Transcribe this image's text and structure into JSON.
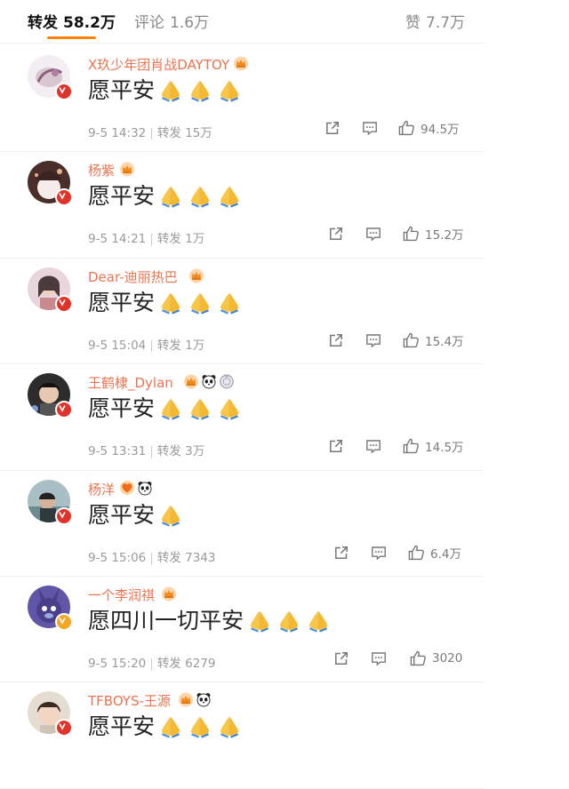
{
  "tabs": {
    "repost": {
      "label": "转发",
      "count": "58.2万"
    },
    "comment": {
      "label": "评论",
      "count": "1.6万"
    },
    "like": {
      "label": "赞",
      "count": "7.7万"
    }
  },
  "colors": {
    "accent": "#ff8200",
    "username": "#eb7350",
    "verified_red": "#e0332a",
    "verified_gold": "#f5a623"
  },
  "items": [
    {
      "username": "X玖少年团肖战DAYTOY",
      "badges": [
        "crown-icon"
      ],
      "comment": "愿平安",
      "pray_count": 3,
      "time": "9-5 14:32",
      "repost_label": "转发",
      "repost_count": "15万",
      "likes": "94.5万",
      "verified": "red",
      "avatar_color": "#d9c7cf"
    },
    {
      "username": "杨紫",
      "badges": [
        "crown-icon"
      ],
      "comment": "愿平安",
      "pray_count": 3,
      "time": "9-5 14:21",
      "repost_label": "转发",
      "repost_count": "1万",
      "likes": "15.2万",
      "verified": "red",
      "avatar_color": "#4a2e28"
    },
    {
      "username": "Dear-迪丽热巴",
      "badges": [
        "crown-icon"
      ],
      "comment": "愿平安",
      "pray_count": 3,
      "time": "9-5 15:04",
      "repost_label": "转发",
      "repost_count": "1万",
      "likes": "15.4万",
      "verified": "red",
      "avatar_color": "#c98a8e"
    },
    {
      "username": "王鹤棣_Dylan",
      "badges": [
        "crown-icon",
        "panda-icon",
        "medal-icon"
      ],
      "comment": "愿平安",
      "pray_count": 3,
      "time": "9-5 13:31",
      "repost_label": "转发",
      "repost_count": "3万",
      "likes": "14.5万",
      "verified": "red",
      "avatar_color": "#2c2c2c"
    },
    {
      "username": "杨洋",
      "badges": [
        "heart-badge-icon",
        "panda-icon"
      ],
      "comment": "愿平安",
      "pray_count": 1,
      "time": "9-5 15:06",
      "repost_label": "转发",
      "repost_count": "7343",
      "likes": "6.4万",
      "verified": "red",
      "avatar_color": "#6f8a8f"
    },
    {
      "username": "一个李润祺",
      "badges": [
        "crown-icon"
      ],
      "comment": "愿四川一切平安",
      "pray_count": 3,
      "time": "9-5 15:20",
      "repost_label": "转发",
      "repost_count": "6279",
      "likes": "3020",
      "verified": "gold",
      "avatar_color": "#4b3f8c"
    },
    {
      "username": "TFBOYS-王源",
      "badges": [
        "crown-icon",
        "panda-icon"
      ],
      "comment": "愿平安",
      "pray_count": 3,
      "time": "",
      "repost_label": "",
      "repost_count": "",
      "likes": "",
      "verified": "red",
      "avatar_color": "#e6ddd2"
    }
  ]
}
